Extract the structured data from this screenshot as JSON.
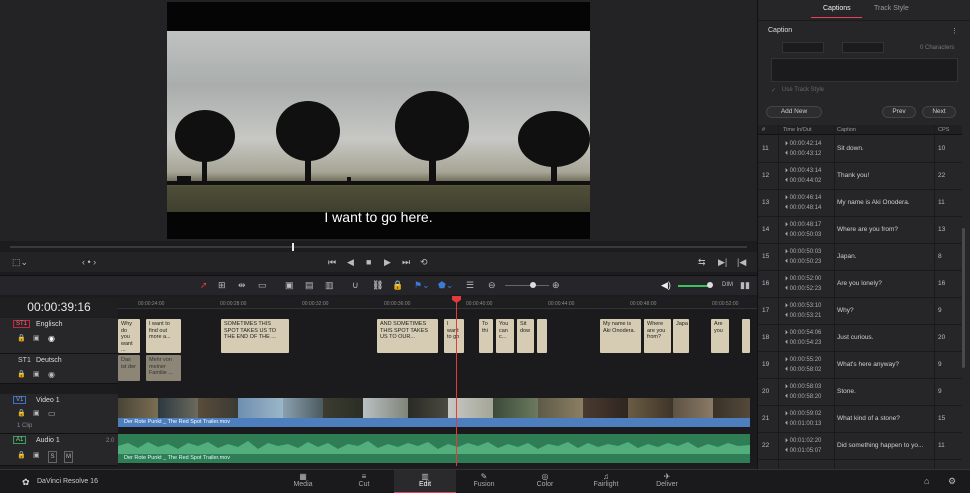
{
  "viewer": {
    "subtitle": "I want to go here.",
    "timecode": "00:00:39:16"
  },
  "ruler": {
    "ticks": [
      "00:00:24:00",
      "00:00:28:00",
      "00:00:32:00",
      "00:00:36:00",
      "00:00:40:00",
      "00:00:44:00",
      "00:00:48:00",
      "00:00:52:00"
    ]
  },
  "tracks": {
    "st1_en": {
      "tag": "ST1",
      "name": "Englisch"
    },
    "st1_de": {
      "tag": "ST1",
      "name": "Deutsch"
    },
    "v1": {
      "tag": "V1",
      "name": "Video 1",
      "clip_count": "1 Clip",
      "clip_name": "Der Rote Punkt _ The Red Spot Trailer.mov"
    },
    "a1": {
      "tag": "A1",
      "name": "Audio 1",
      "level": "2.0",
      "clip_name": "Der Rote Punkt _ The Red Spot Trailer.mov",
      "s_btn": "S",
      "m_btn": "M"
    }
  },
  "subtitle_clips_en": [
    "Why do you want ...",
    "I want to find out more a...",
    "SOMETIMES THIS SPOT TAKES US TO THE END OF THE ...",
    "AND SOMETIMES THIS SPOT TAKES US TO OUR...",
    "I want to go",
    "To thi",
    "You can c...",
    "Sit dow",
    "My name is Aki Onodera.",
    "Where are you from?",
    "Japa",
    "Are you"
  ],
  "subtitle_clips_de": [
    "Das ist der",
    "Mehr von meiner Familie ..."
  ],
  "bottom_nav": {
    "app": "DaVinci Resolve 16",
    "pages": [
      "Media",
      "Cut",
      "Edit",
      "Fusion",
      "Color",
      "Fairlight",
      "Deliver"
    ],
    "active": "Edit"
  },
  "panel": {
    "tabs": [
      "Captions",
      "Track Style"
    ],
    "active_tab": "Captions",
    "section": "Caption",
    "chars": "0 Characters",
    "use_track_style": "Use Track Style",
    "add_new": "Add New",
    "prev": "Prev",
    "next": "Next",
    "columns": [
      "#",
      "Time In/Out",
      "Caption",
      "CPS"
    ],
    "rows": [
      {
        "n": "11",
        "in": "00:00:42:14",
        "out": "00:00:43:12",
        "caption": "Sit down.",
        "cps": "10"
      },
      {
        "n": "12",
        "in": "00:00:43:14",
        "out": "00:00:44:02",
        "caption": "Thank you!",
        "cps": "22"
      },
      {
        "n": "13",
        "in": "00:00:46:14",
        "out": "00:00:48:14",
        "caption": "My name is Aki Onodera.",
        "cps": "11"
      },
      {
        "n": "14",
        "in": "00:00:48:17",
        "out": "00:00:50:03",
        "caption": "Where are you from?",
        "cps": "13"
      },
      {
        "n": "15",
        "in": "00:00:50:03",
        "out": "00:00:50:23",
        "caption": "Japan.",
        "cps": "8"
      },
      {
        "n": "16",
        "in": "00:00:52:00",
        "out": "00:00:52:23",
        "caption": "Are you lonely?",
        "cps": "16"
      },
      {
        "n": "17",
        "in": "00:00:53:10",
        "out": "00:00:53:21",
        "caption": "Why?",
        "cps": "9"
      },
      {
        "n": "18",
        "in": "00:00:54:06",
        "out": "00:00:54:23",
        "caption": "Just curious.",
        "cps": "20"
      },
      {
        "n": "19",
        "in": "00:00:55:20",
        "out": "00:00:58:02",
        "caption": "What's here anyway?",
        "cps": "9"
      },
      {
        "n": "20",
        "in": "00:00:58:03",
        "out": "00:00:58:20",
        "caption": "Stone.",
        "cps": "9"
      },
      {
        "n": "21",
        "in": "00:00:59:02",
        "out": "00:01:00:13",
        "caption": "What kind of a stone?",
        "cps": "15"
      },
      {
        "n": "22",
        "in": "00:01:02:20",
        "out": "00:01:05:07",
        "caption": "Did something happen to yo...",
        "cps": "11"
      }
    ]
  }
}
